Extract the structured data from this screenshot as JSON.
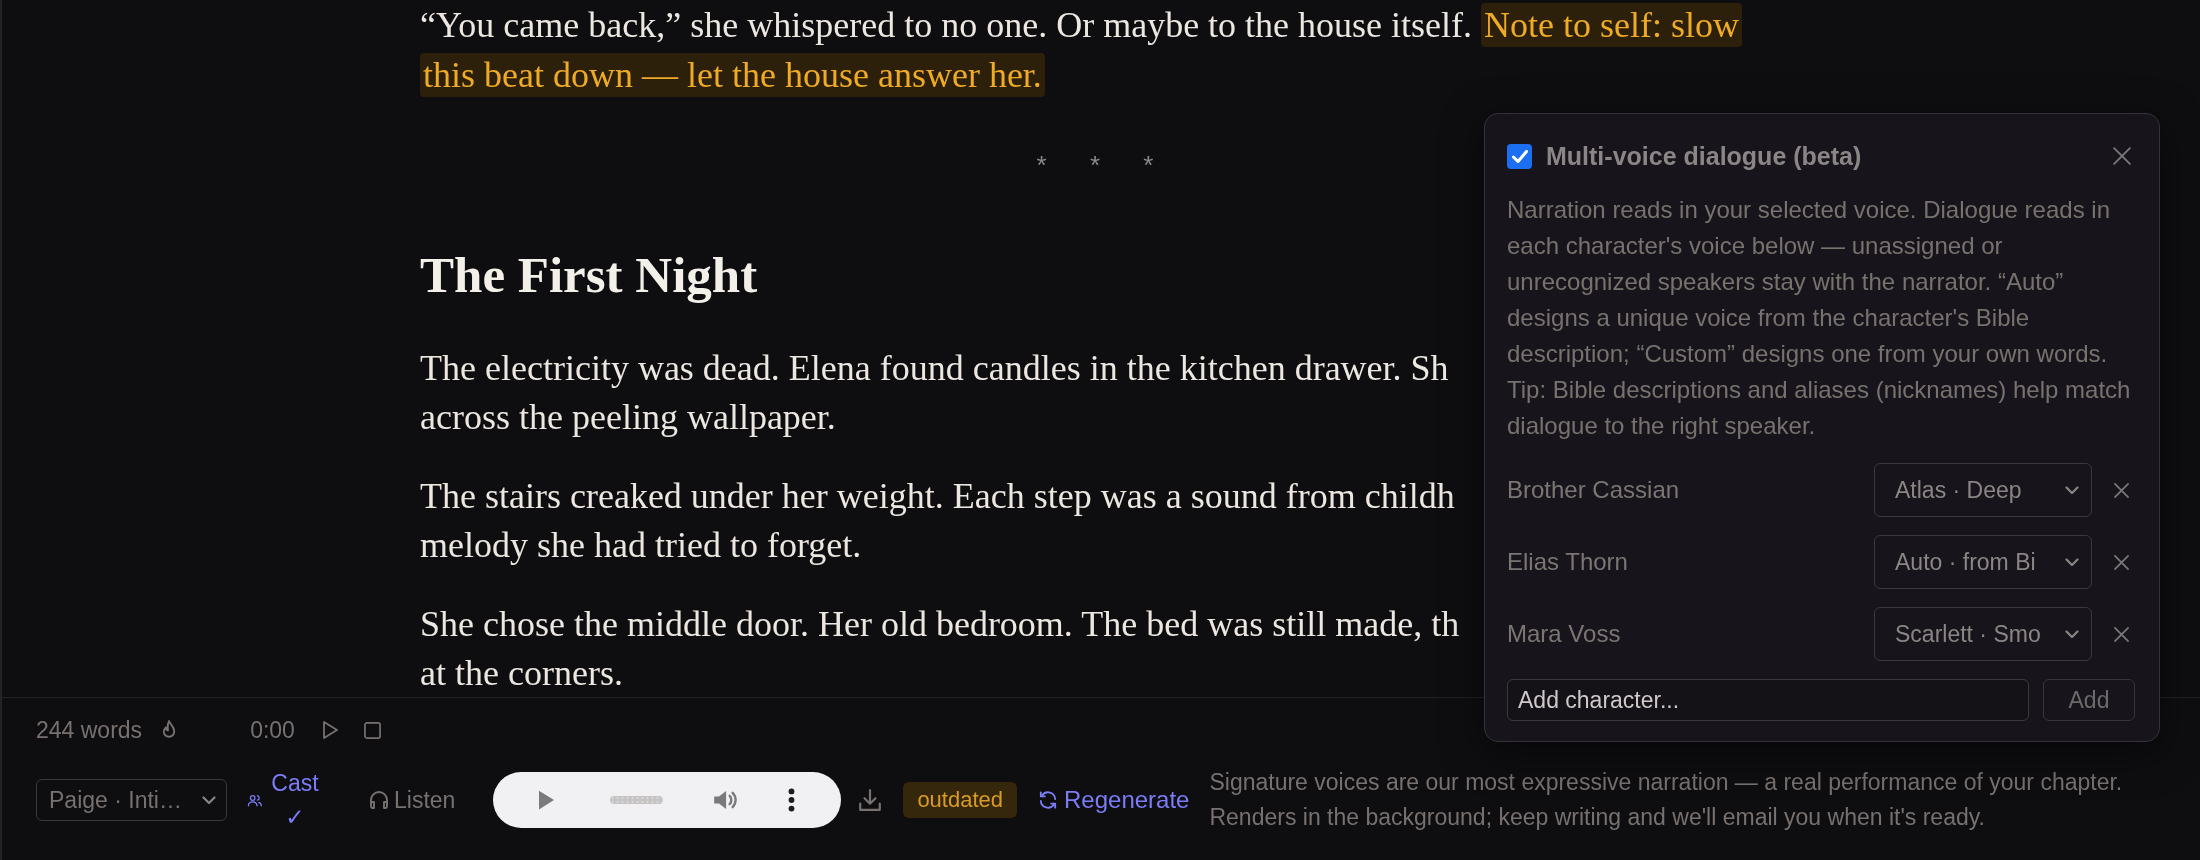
{
  "editor": {
    "blocks": [
      {
        "kind": "paragraph",
        "text": "“You came back,” she whispered to no one. Or maybe to the house itself.",
        "note": "Note to self: slow this beat down — let the house answer her."
      },
      {
        "kind": "scene_break",
        "text": "* * *"
      },
      {
        "kind": "heading",
        "text": "The First Night"
      },
      {
        "kind": "cut_paragraph",
        "lines": [
          "The electricity was dead. Elena found candles in the kitchen drawer. Sh",
          "across the peeling wallpaper."
        ]
      },
      {
        "kind": "cut_paragraph",
        "lines": [
          "The stairs creaked under her weight. Each step was a sound from childh",
          "melody she had tried to forget."
        ]
      },
      {
        "kind": "cut_paragraph",
        "lines": [
          "She chose the middle door. Her old bedroom. The bed was still made, th",
          "at the corners."
        ]
      }
    ]
  },
  "footer": {
    "word_count": "244 words",
    "time": "0:00",
    "voice_select": "Paige · Inti…",
    "modes": [
      {
        "label": "Cast ✓",
        "selected": true
      },
      {
        "label": "Listen",
        "selected": false
      }
    ],
    "badge": "outdated",
    "regenerate": "Regenerate",
    "note": "Signature voices are our most expressive narration — a real performance of your chapter. Renders in the background; keep writing and we'll email you when it's ready."
  },
  "dialogue_panel": {
    "checked": true,
    "title": "Multi-voice dialogue (beta)",
    "description": "Narration reads in your selected voice. Dialogue reads in each character's voice below — unassigned or unrecognized speakers stay with the narrator. “Auto” designs a unique voice from the character's Bible description; “Custom” designs one from your own words. Tip: Bible descriptions and aliases (nicknames) help match dialogue to the right speaker.",
    "characters": [
      {
        "name": "Brother Cassian",
        "voice": "Atlas · Deep"
      },
      {
        "name": "Elias Thorn",
        "voice": "Auto · from Bi"
      },
      {
        "name": "Mara Voss",
        "voice": "Scarlett · Smo"
      }
    ],
    "add_field": {
      "placeholder": "Add character..."
    },
    "add_button": {
      "label": "Add",
      "disabled": true
    }
  }
}
